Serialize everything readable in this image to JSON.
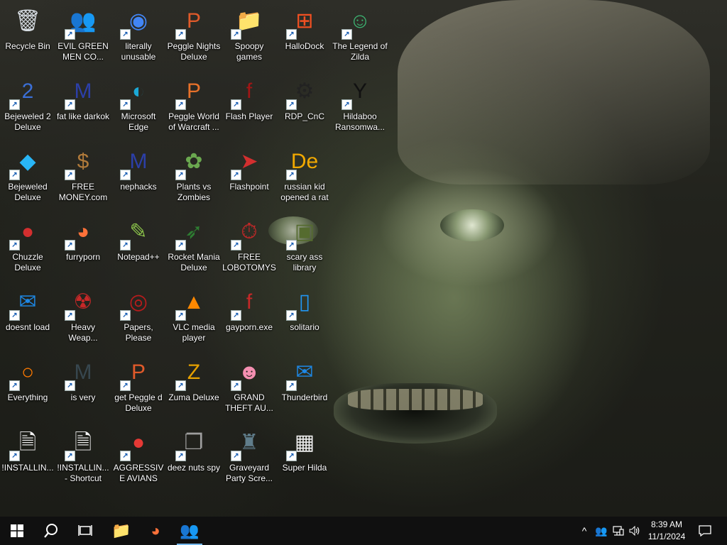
{
  "desktop": {
    "icons": [
      {
        "label": "Recycle Bin",
        "glyph": "🗑",
        "color": "#d7dde3"
      },
      {
        "label": "EVIL GREEN MEN CO...",
        "glyph": "👥",
        "color": "#3fae3a"
      },
      {
        "label": "literally unusable",
        "glyph": "◉",
        "color": "#4285f4"
      },
      {
        "label": "Peggle Nights Deluxe",
        "glyph": "P",
        "color": "#e05a2a"
      },
      {
        "label": "Spoopy games",
        "glyph": "📁",
        "color": "#e8c06a"
      },
      {
        "label": "HalloDock",
        "glyph": "⊞",
        "color": "#f25022"
      },
      {
        "label": "The Legend of Zilda",
        "glyph": "☺",
        "color": "#3cb371"
      },
      {
        "label": "Bejeweled 2 Deluxe",
        "glyph": "2",
        "color": "#3b6fd6"
      },
      {
        "label": "fat like darkok",
        "glyph": "M",
        "color": "#2c3fa8"
      },
      {
        "label": "Microsoft Edge",
        "glyph": "◐",
        "color": "#1ba8d6"
      },
      {
        "label": "Peggle World of Warcraft ...",
        "glyph": "P",
        "color": "#e8712a"
      },
      {
        "label": "Flash Player",
        "glyph": "f",
        "color": "#a31515"
      },
      {
        "label": "RDP_CnC",
        "glyph": "⚙",
        "color": "#222222"
      },
      {
        "label": "Hildaboo Ransomwa...",
        "glyph": "Y",
        "color": "#111111"
      },
      {
        "label": "Bejeweled Deluxe",
        "glyph": "◆",
        "color": "#29b6f6"
      },
      {
        "label": "FREE MONEY.com",
        "glyph": "$",
        "color": "#b07a3a"
      },
      {
        "label": "nephacks",
        "glyph": "M",
        "color": "#2c3fa8"
      },
      {
        "label": "Plants vs Zombies",
        "glyph": "✿",
        "color": "#6aa84f"
      },
      {
        "label": "Flashpoint",
        "glyph": "➤",
        "color": "#d32f2f"
      },
      {
        "label": "russian kid opened a rat",
        "glyph": "De",
        "color": "#f2a900"
      },
      {
        "label": "Chuzzle Deluxe",
        "glyph": "●",
        "color": "#d32f2f"
      },
      {
        "label": "furryporn",
        "glyph": "◕",
        "color": "#ff7139"
      },
      {
        "label": "Notepad++",
        "glyph": "✎",
        "color": "#8bc34a"
      },
      {
        "label": "Rocket Mania Deluxe",
        "glyph": "➶",
        "color": "#2e7d32"
      },
      {
        "label": "FREE LOBOTOMYS",
        "glyph": "⏱",
        "color": "#c62828"
      },
      {
        "label": "scary ass library",
        "glyph": "▣",
        "color": "#556b2f"
      },
      {
        "label": "doesnt load",
        "glyph": "✉",
        "color": "#1e88e5"
      },
      {
        "label": "Heavy Weap...",
        "glyph": "☢",
        "color": "#c62828"
      },
      {
        "label": "Papers, Please",
        "glyph": "◎",
        "color": "#b71c1c"
      },
      {
        "label": "VLC media player",
        "glyph": "▲",
        "color": "#ff8800"
      },
      {
        "label": "gayporn.exe",
        "glyph": "f",
        "color": "#c62828"
      },
      {
        "label": "solitario",
        "glyph": "▯",
        "color": "#2196f3"
      },
      {
        "label": "Everything",
        "glyph": "○",
        "color": "#ff7a00"
      },
      {
        "label": "is very",
        "glyph": "M",
        "color": "#37474f"
      },
      {
        "label": "get Peggle d Deluxe",
        "glyph": "P",
        "color": "#e05a2a"
      },
      {
        "label": "Zuma Deluxe",
        "glyph": "Z",
        "color": "#e6a100"
      },
      {
        "label": "GRAND THEFT AU...",
        "glyph": "☻",
        "color": "#f48fb1"
      },
      {
        "label": "Thunderbird",
        "glyph": "✉",
        "color": "#1e88e5"
      },
      {
        "label": "!INSTALLIN...",
        "glyph": "🗎",
        "color": "#f5f5f5"
      },
      {
        "label": "!INSTALLIN... - Shortcut",
        "glyph": "🗎",
        "color": "#f5f5f5"
      },
      {
        "label": "AGGRESSIVE AVIANS",
        "glyph": "●",
        "color": "#e53935"
      },
      {
        "label": "deez nuts spy",
        "glyph": "❐",
        "color": "#9e9e9e"
      },
      {
        "label": "Graveyard Party Scre...",
        "glyph": "♜",
        "color": "#607d8b"
      },
      {
        "label": "Super Hilda",
        "glyph": "▦",
        "color": "#eeeeee"
      }
    ]
  },
  "taskbar": {
    "start_icon": "windows-logo",
    "search_icon": "search",
    "task_view_icon": "task-view",
    "pinned": [
      {
        "name": "file-explorer",
        "glyph": "📁",
        "color": "#f2c94c"
      },
      {
        "name": "firefox",
        "glyph": "◕",
        "color": "#ff7139"
      },
      {
        "name": "evil-green-men",
        "glyph": "👥",
        "color": "#3fae3a"
      }
    ],
    "tray": {
      "chevron": "^",
      "time": "8:39 AM",
      "date": "11/1/2024"
    }
  },
  "colors": {
    "taskbar_bg": "#101010",
    "accent": "#76b9ed"
  }
}
